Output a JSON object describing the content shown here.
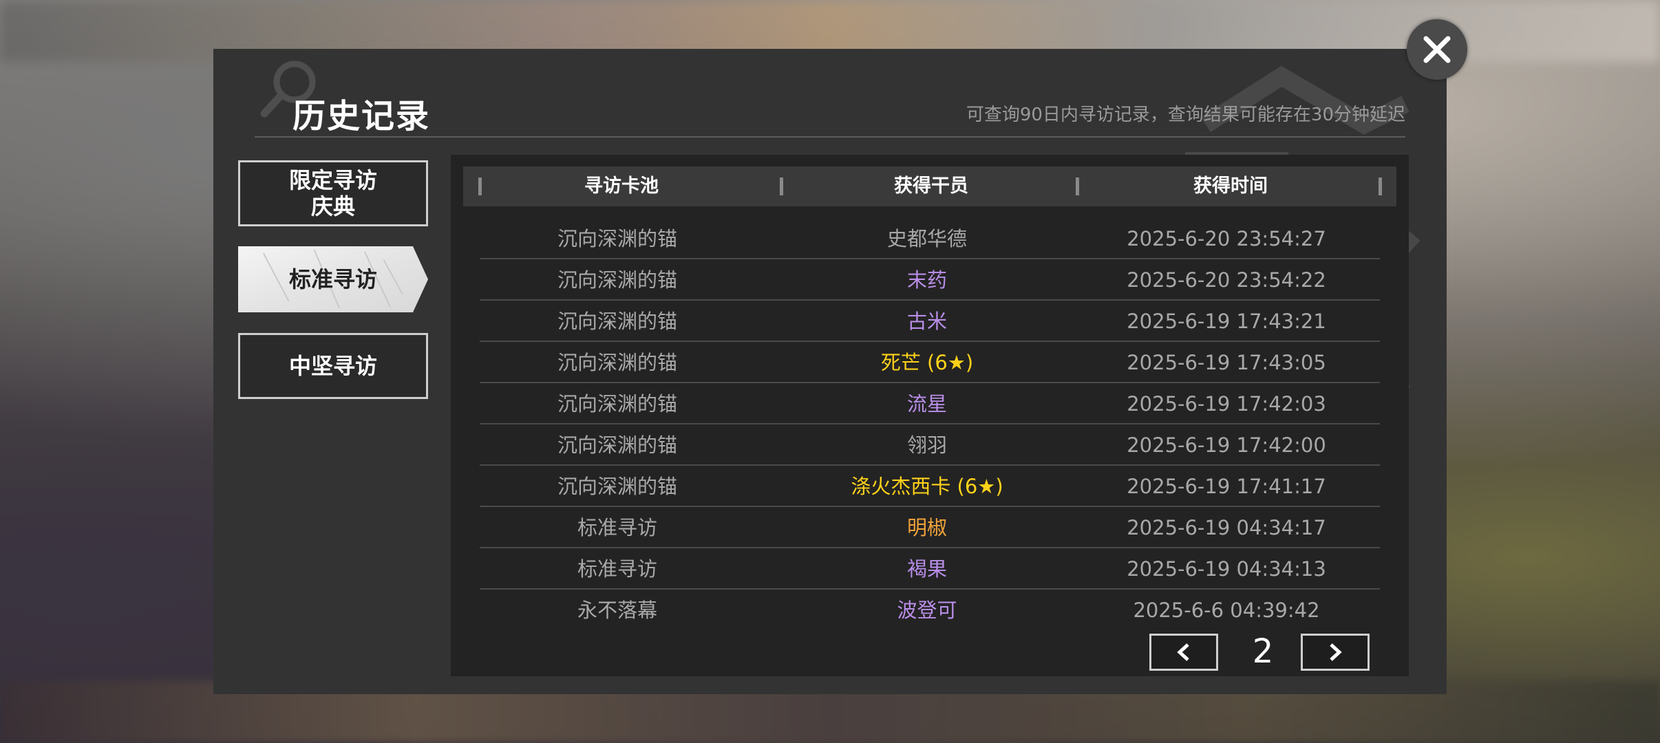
{
  "dialog": {
    "title": "历史记录",
    "notice": "可查询90日内寻访记录，查询结果可能存在30分钟延迟"
  },
  "tabs": [
    {
      "label": "限定寻访\n庆典",
      "line1": "限定寻访",
      "line2": "庆典",
      "selected": false
    },
    {
      "label": "标准寻访",
      "selected": true
    },
    {
      "label": "中坚寻访",
      "selected": false
    }
  ],
  "table": {
    "headers": [
      "寻访卡池",
      "获得干员",
      "获得时间"
    ],
    "rows": [
      {
        "pool": "沉向深渊的锚",
        "operator": "史都华德",
        "time": "2025-6-20 23:54:27",
        "color": "#a8a8a8"
      },
      {
        "pool": "沉向深渊的锚",
        "operator": "末药",
        "time": "2025-6-20 23:54:22",
        "color": "#b98ee8"
      },
      {
        "pool": "沉向深渊的锚",
        "operator": "古米",
        "time": "2025-6-19 17:43:21",
        "color": "#b98ee8"
      },
      {
        "pool": "沉向深渊的锚",
        "operator": "死芒 (6★)",
        "time": "2025-6-19 17:43:05",
        "color": "#ffd21a"
      },
      {
        "pool": "沉向深渊的锚",
        "operator": "流星",
        "time": "2025-6-19 17:42:03",
        "color": "#b98ee8"
      },
      {
        "pool": "沉向深渊的锚",
        "operator": "翎羽",
        "time": "2025-6-19 17:42:00",
        "color": "#a8a8a8"
      },
      {
        "pool": "沉向深渊的锚",
        "operator": "涤火杰西卡 (6★)",
        "time": "2025-6-19 17:41:17",
        "color": "#ffd21a"
      },
      {
        "pool": "标准寻访",
        "operator": "明椒",
        "time": "2025-6-19 04:34:17",
        "color": "#f0a23a"
      },
      {
        "pool": "标准寻访",
        "operator": "褐果",
        "time": "2025-6-19 04:34:13",
        "color": "#b98ee8"
      },
      {
        "pool": "永不落幕",
        "operator": "波登可",
        "time": "2025-6-6 04:39:42",
        "color": "#b98ee8"
      }
    ]
  },
  "pager": {
    "page": "2"
  },
  "icons": {
    "close": "close-icon",
    "prev": "chevron-left-icon",
    "next": "chevron-right-icon",
    "watermark": "search-icon"
  }
}
